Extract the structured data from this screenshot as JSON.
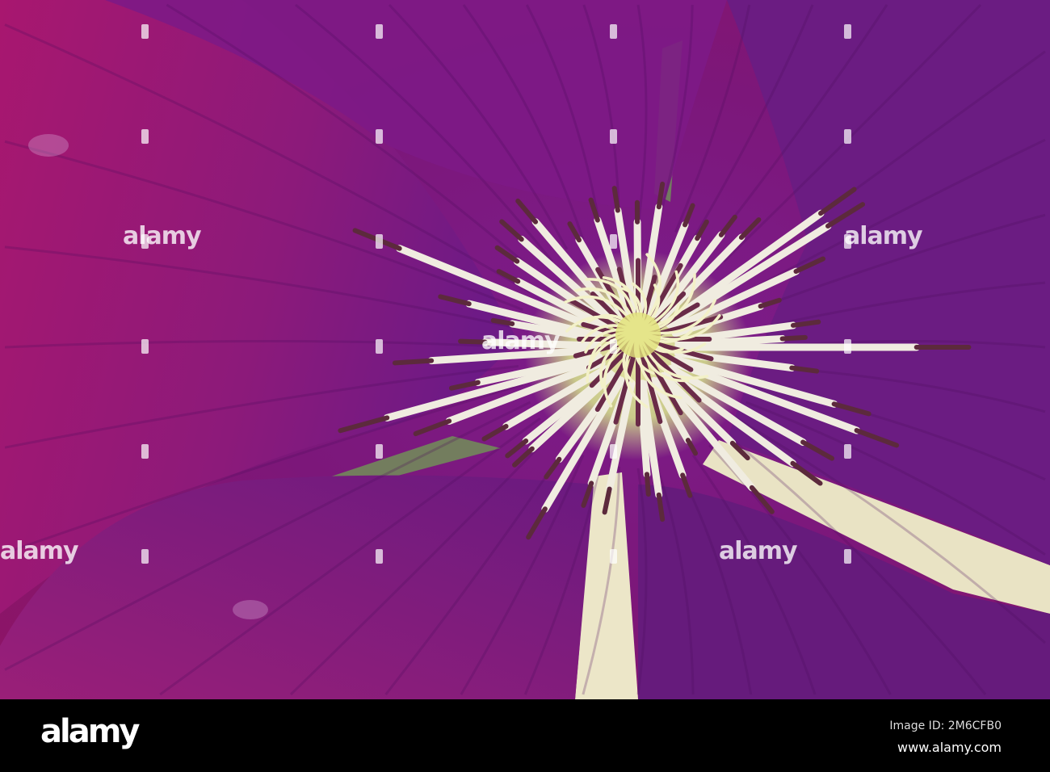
{
  "photo": {
    "subject": "Clematis flower close-up",
    "colors": {
      "petal": "#8e1a7e",
      "petal_dark": "#5a0d6a",
      "petal_bright": "#b4197f",
      "stamen": "#f0ece0",
      "anther": "#5c2a3c",
      "center": "#e8e6a6",
      "leaf": "#7a9a5a",
      "gap": "#ece6c8"
    }
  },
  "watermark": {
    "text": "alamy"
  },
  "footer": {
    "logo": "alamy",
    "image_id": "Image ID: 2M6CFB0",
    "website": "www.alamy.com"
  }
}
